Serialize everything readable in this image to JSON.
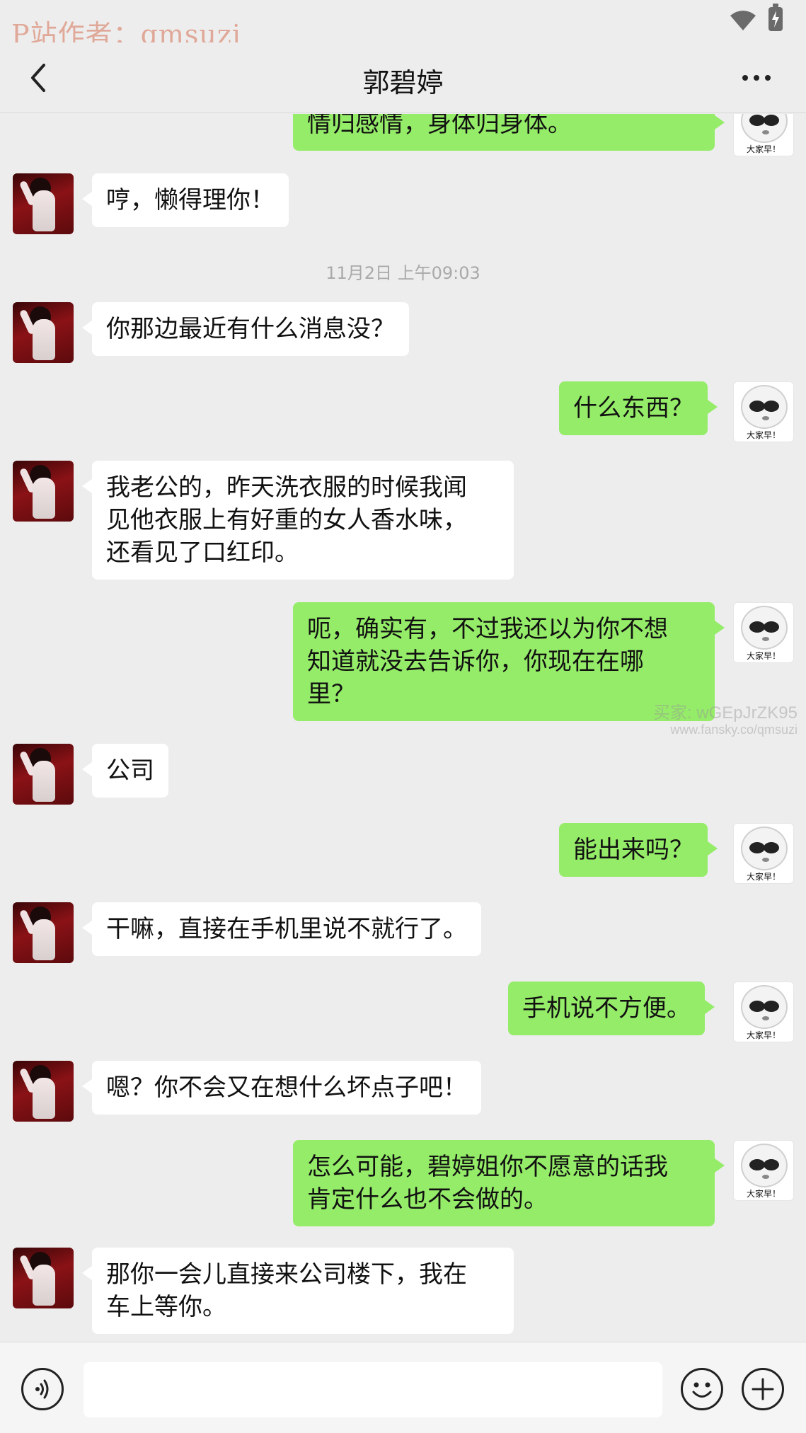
{
  "status_bar": {
    "watermark": "P站作者：qmsuzi",
    "icons": [
      "wifi-icon",
      "battery-charging-icon"
    ]
  },
  "header": {
    "title": "郭碧婷",
    "back_icon": "chevron-left-icon",
    "more_icon": "more-horizontal-icon"
  },
  "messages": [
    {
      "from": "me",
      "text": "情归感情，身体归身体。"
    },
    {
      "from": "her",
      "text": "哼，懒得理你！"
    },
    {
      "type": "time",
      "text": "11月2日 上午09:03"
    },
    {
      "from": "her",
      "text": "你那边最近有什么消息没？"
    },
    {
      "from": "me",
      "text": "什么东西？"
    },
    {
      "from": "her",
      "lines": [
        "我老公的，昨天洗衣服的时候我闻",
        "见他衣服上有好重的女人香水味，",
        "还看见了口红印。"
      ]
    },
    {
      "from": "me",
      "lines": [
        "呃，确实有，不过我还以为你不想",
        "知道就没去告诉你，你现在在哪",
        "里？"
      ]
    },
    {
      "from": "her",
      "text": "公司"
    },
    {
      "from": "me",
      "text": "能出来吗？"
    },
    {
      "from": "her",
      "text": "干嘛，直接在手机里说不就行了。"
    },
    {
      "from": "me",
      "text": "手机说不方便。"
    },
    {
      "from": "her",
      "text": "嗯？你不会又在想什么坏点子吧！"
    },
    {
      "from": "me",
      "lines": [
        "怎么可能，碧婷姐你不愿意的话我",
        "肯定什么也不会做的。"
      ]
    },
    {
      "from": "her",
      "lines": [
        "那你一会儿直接来公司楼下，我在",
        "车上等你。"
      ]
    }
  ],
  "avatars": {
    "me_caption": "大家早！"
  },
  "watermark_mid": {
    "line1": "买家: wGEpJrZK95",
    "line2": "www.fansky.co/qmsuzi"
  },
  "input_bar": {
    "voice_icon": "voice-icon",
    "emoji_icon": "emoji-icon",
    "plus_icon": "plus-icon",
    "input_value": ""
  },
  "colors": {
    "background": "#ededed",
    "my_bubble": "#95ec69",
    "her_bubble": "#ffffff",
    "timestamp": "#a9a9a9",
    "watermark": "#e0a898"
  }
}
